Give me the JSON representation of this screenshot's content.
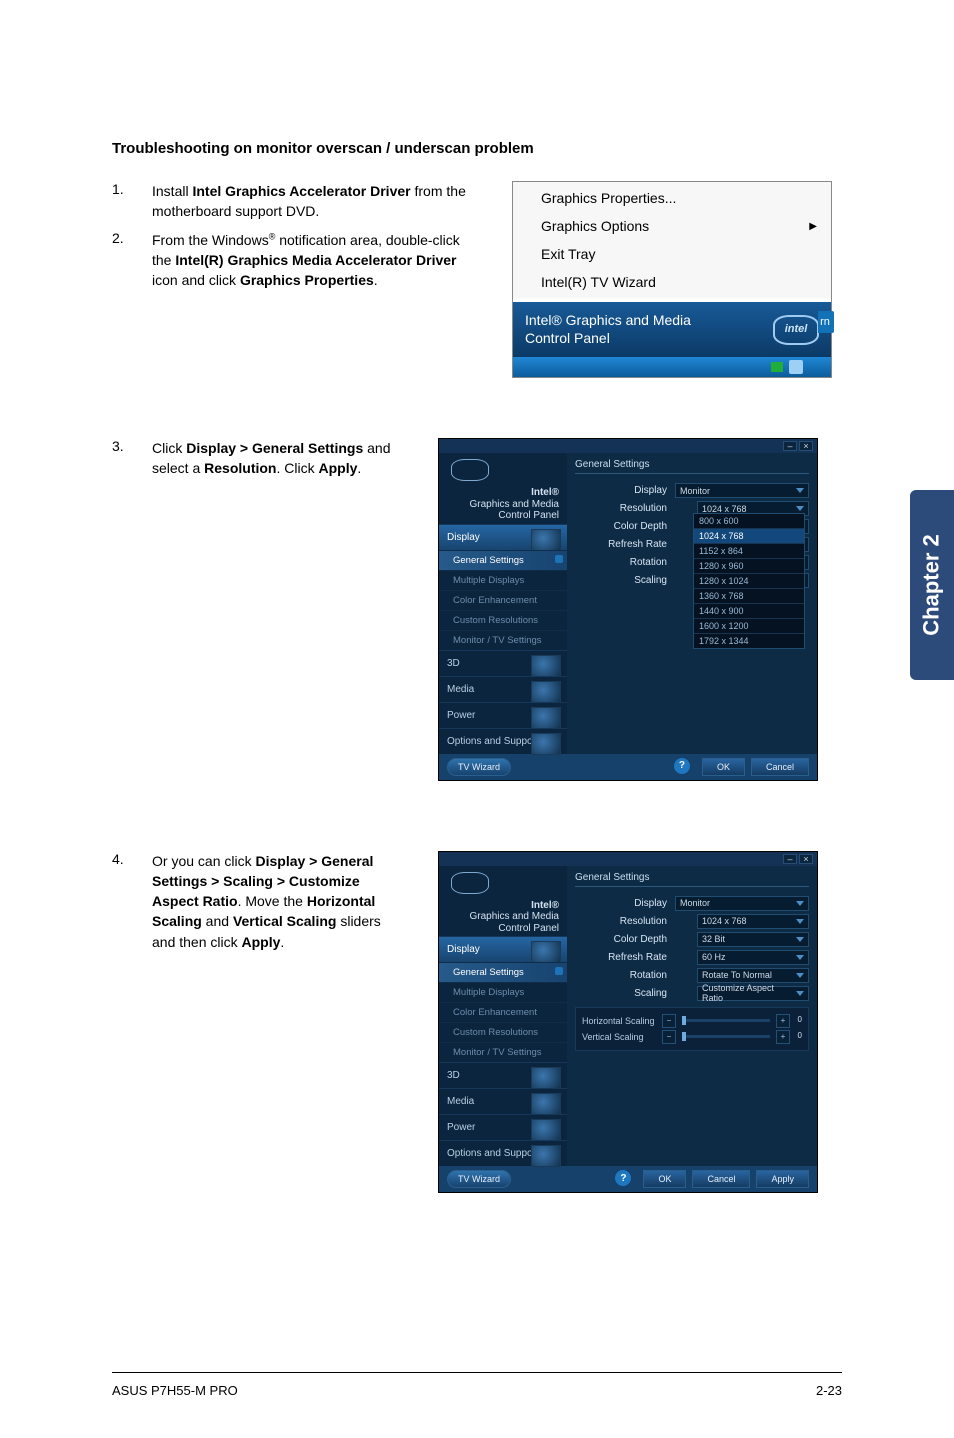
{
  "page": {
    "heading": "Troubleshooting on monitor overscan / underscan problem"
  },
  "steps": [
    {
      "num": "1.",
      "segments": [
        "Install ",
        {
          "b": "Intel Graphics Accelerator Driver"
        },
        " from the motherboard support DVD."
      ]
    },
    {
      "num": "2.",
      "segments": [
        "From the Windows",
        {
          "sup": "®"
        },
        " notification area, double-click the ",
        {
          "b": "Intel(R) Graphics Media Accelerator Driver"
        },
        " icon and click ",
        {
          "b": "Graphics Properties"
        },
        "."
      ]
    },
    {
      "num": "3.",
      "segments": [
        "Click ",
        {
          "b": "Display > General Settings"
        },
        " and select a ",
        {
          "b": "Resolution"
        },
        ". Click ",
        {
          "b": "Apply"
        },
        "."
      ]
    },
    {
      "num": "4.",
      "segments": [
        "Or you can click ",
        {
          "b": "Display > General Settings > Scaling > Customize Aspect Ratio"
        },
        ". Move the ",
        {
          "b": "Horizontal Scaling"
        },
        " and ",
        {
          "b": "Vertical Scaling"
        },
        " sliders and then click ",
        {
          "b": "Apply"
        },
        "."
      ]
    }
  ],
  "context_menu": {
    "items": [
      {
        "label": "Graphics Properties...",
        "arrow": false
      },
      {
        "label": "Graphics Options",
        "arrow": true
      },
      {
        "label": "Exit Tray",
        "arrow": false
      },
      {
        "label": "Intel(R) TV Wizard",
        "arrow": false
      }
    ],
    "panel_banner_line1": "Intel® Graphics and Media",
    "panel_banner_line2": "Control Panel",
    "logo_text": "intel",
    "rn_badge": "rn"
  },
  "panel2": {
    "brand_t1": "Intel®",
    "brand_t2": "Graphics and Media",
    "brand_t3": "Control Panel",
    "side": {
      "display": "Display",
      "subs": [
        "General Settings",
        "Multiple Displays",
        "Color Enhancement",
        "Custom Resolutions",
        "Monitor / TV Settings"
      ],
      "items": [
        "3D",
        "Media",
        "Power",
        "Options and Support"
      ]
    },
    "tab": "General Settings",
    "labels": {
      "display": "Display",
      "monitor": "Monitor",
      "resolution": "Resolution",
      "color_depth": "Color Depth",
      "refresh_rate": "Refresh Rate",
      "rotation": "Rotation",
      "scaling": "Scaling"
    },
    "resolution_selected": "1024 x 768",
    "resolution_options": [
      "800 x 600",
      "1024 x 768",
      "1152 x 864",
      "1280 x 960",
      "1280 x 1024",
      "1360 x 768",
      "1440 x 900",
      "1600 x 1200",
      "1792 x 1344"
    ],
    "wizard": "TV Wizard",
    "buttons": {
      "ok": "OK",
      "cancel": "Cancel"
    }
  },
  "panel3": {
    "brand_t1": "Intel®",
    "brand_t2": "Graphics and Media",
    "brand_t3": "Control Panel",
    "side": {
      "display": "Display",
      "subs": [
        "General Settings",
        "Multiple Displays",
        "Color Enhancement",
        "Custom Resolutions",
        "Monitor / TV Settings"
      ],
      "items": [
        "3D",
        "Media",
        "Power",
        "Options and Support"
      ]
    },
    "tab": "General Settings",
    "labels": {
      "display": "Display",
      "monitor": "Monitor",
      "resolution": "Resolution",
      "color_depth": "Color Depth",
      "refresh_rate": "Refresh Rate",
      "rotation": "Rotation",
      "scaling": "Scaling"
    },
    "values": {
      "resolution": "1024 x 768",
      "color_depth": "32 Bit",
      "refresh_rate": "60 Hz",
      "rotation": "Rotate To Normal",
      "scaling": "Customize Aspect Ratio"
    },
    "slider_h": "Horizontal Scaling",
    "slider_v": "Vertical Scaling",
    "slider_val": "0",
    "wizard": "TV Wizard",
    "buttons": {
      "ok": "OK",
      "cancel": "Cancel",
      "apply": "Apply"
    }
  },
  "side_tab": "Chapter 2",
  "footer": {
    "left": "ASUS P7H55-M PRO",
    "right": "2-23"
  }
}
